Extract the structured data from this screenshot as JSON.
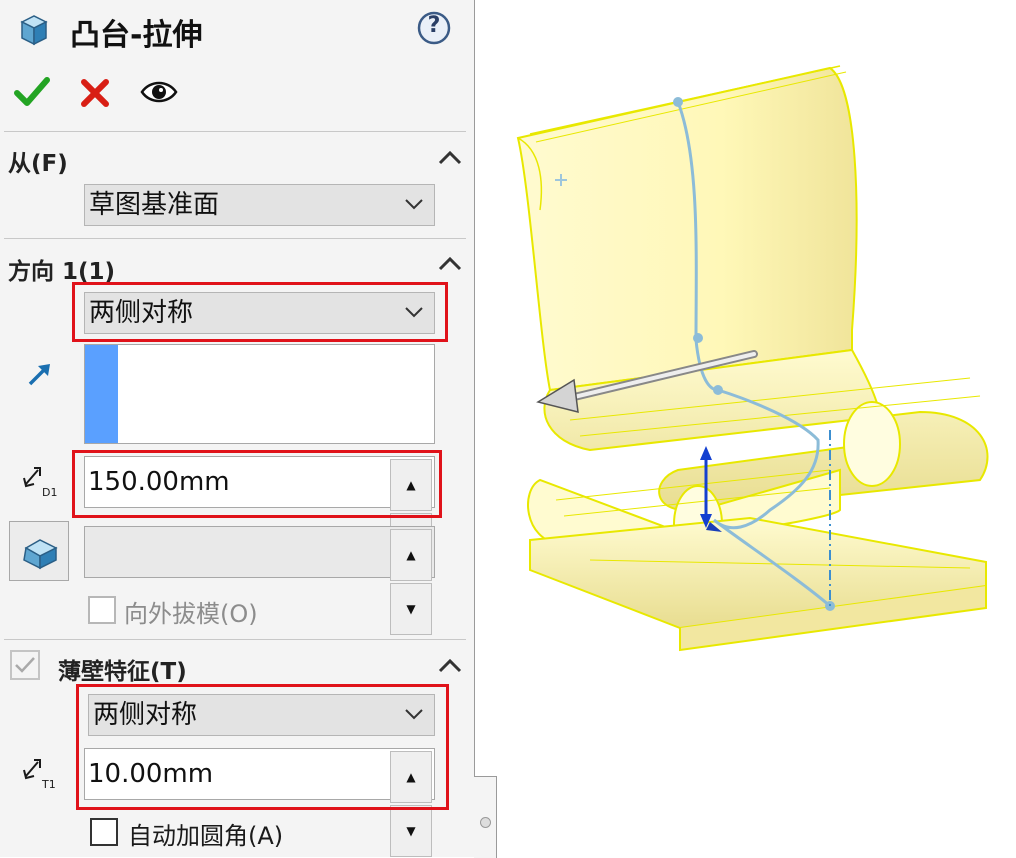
{
  "header": {
    "title": "凸台-拉伸",
    "help_label": "?"
  },
  "actions": {
    "ok_icon": "green-checkmark-icon",
    "cancel_icon": "red-x-icon",
    "preview_icon": "eye-icon"
  },
  "from_section": {
    "title": "从(F)",
    "start_condition": "草图基准面"
  },
  "direction1": {
    "title": "方向 1(1)",
    "end_condition": "两侧对称",
    "depth_value": "150.00mm",
    "depth_symbol": "D1",
    "draft_value": "",
    "draft_outward_label": "向外拔模(O)",
    "draft_outward_checked": false
  },
  "thin_feature": {
    "title": "薄壁特征(T)",
    "enabled": true,
    "type": "两侧对称",
    "thickness_value": "10.00mm",
    "thickness_symbol": "T1",
    "auto_fillet_label": "自动加圆角(A)",
    "auto_fillet_checked": false
  },
  "colors": {
    "highlight": "#e0121a",
    "accent_blue": "#5aa0ff",
    "model_fill": "#fffbb8",
    "model_edge": "#e8e800"
  }
}
